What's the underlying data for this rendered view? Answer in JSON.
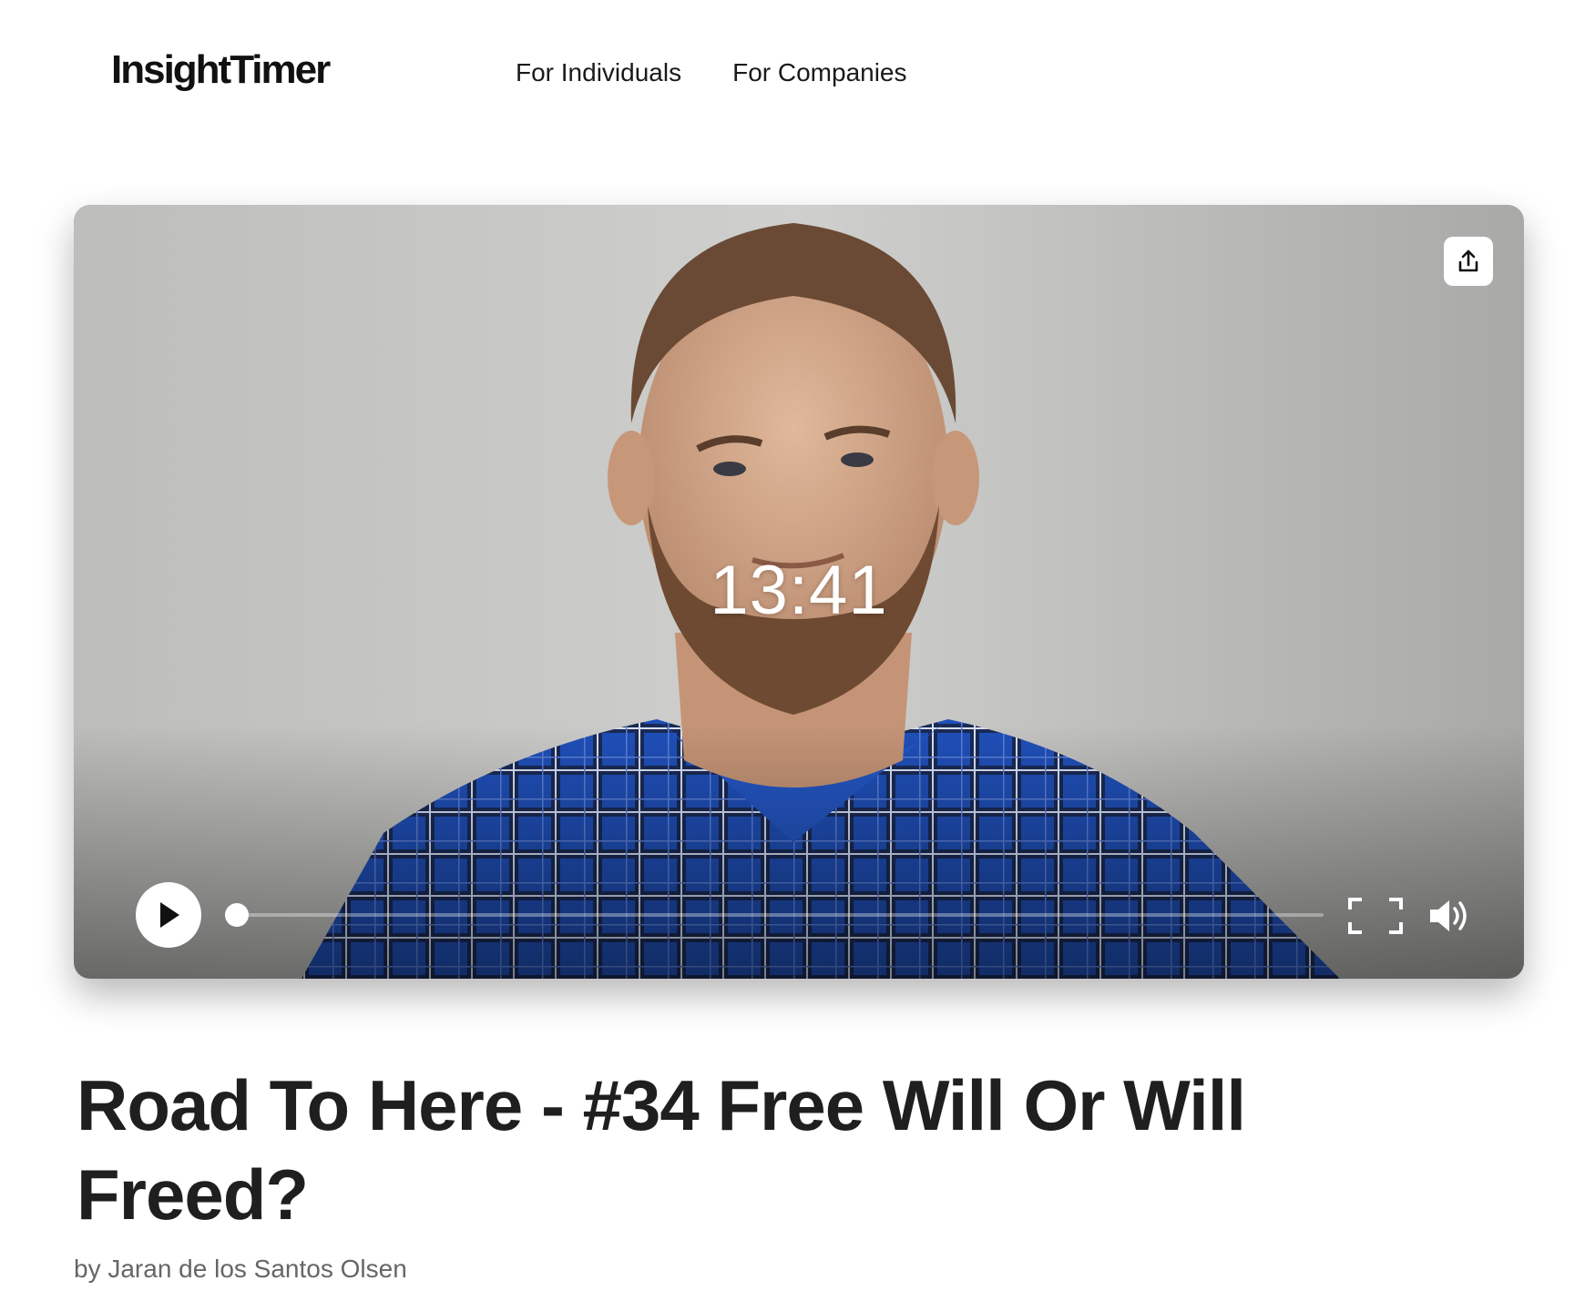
{
  "header": {
    "logo_text": "InsightTimer",
    "nav": [
      {
        "label": "For Individuals"
      },
      {
        "label": "For Companies"
      }
    ]
  },
  "player": {
    "time": "13:41",
    "progress": 0.0,
    "icons": {
      "share": "share-upload-icon",
      "play": "play-icon",
      "fullscreen": "fullscreen-icon",
      "volume": "volume-icon"
    }
  },
  "content": {
    "title": "Road To Here - #34 Free Will Or Will Freed?",
    "author": "by Jaran de los Santos Olsen"
  }
}
